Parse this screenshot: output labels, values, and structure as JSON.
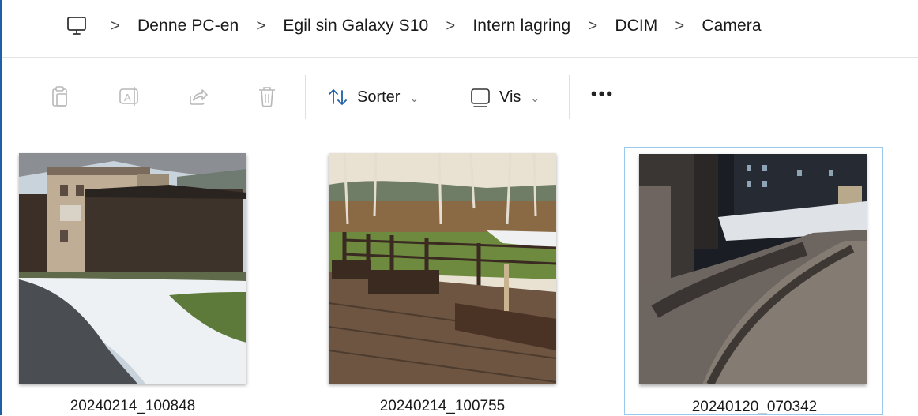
{
  "breadcrumb": {
    "items": [
      "Denne PC-en",
      "Egil sin Galaxy S10",
      "Intern lagring",
      "DCIM",
      "Camera"
    ],
    "separator": ">",
    "root_icon": "computer-icon"
  },
  "toolbar": {
    "icons": [
      "copy-icon",
      "rename-icon",
      "share-icon",
      "delete-icon"
    ],
    "sort_label": "Sorter",
    "view_label": "Vis",
    "more_label": "•••"
  },
  "files": [
    {
      "name": "20240214_100848",
      "selected": false
    },
    {
      "name": "20240214_100755",
      "selected": false
    },
    {
      "name": "20240120_070342",
      "selected": true
    }
  ],
  "colors": {
    "accent": "#1f5fa8",
    "selection_border": "#99c9ef",
    "sort_icon": "#1f5fa8"
  }
}
